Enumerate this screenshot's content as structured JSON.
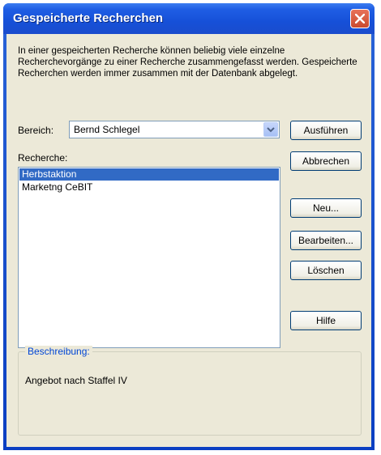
{
  "window": {
    "title": "Gespeicherte Recherchen"
  },
  "intro_text": "In einer gespeicherten Recherche können beliebig viele einzelne Recherchevorgänge zu einer Recherche zusammengefasst werden. Gespeicherte Recherchen werden immer zusammen mit der Datenbank abgelegt.",
  "bereich": {
    "label": "Bereich:",
    "selected": "Bernd Schlegel"
  },
  "recherche": {
    "label": "Recherche:",
    "items": [
      {
        "label": "Herbstaktion",
        "selected": true
      },
      {
        "label": "Marketng CeBIT",
        "selected": false
      }
    ]
  },
  "buttons": {
    "ausfuehren": "Ausführen",
    "abbrechen": "Abbrechen",
    "neu": "Neu...",
    "bearbeiten": "Bearbeiten...",
    "loeschen": "Löschen",
    "hilfe": "Hilfe"
  },
  "beschreibung": {
    "title": "Beschreibung:",
    "text": "Angebot nach Staffel IV"
  },
  "icons": {
    "close": "close-icon",
    "dropdown": "chevron-down-icon"
  },
  "colors": {
    "titlebar": "#1650d8",
    "selection": "#316ac5",
    "face": "#ece9d8",
    "group_title": "#0046d5"
  }
}
